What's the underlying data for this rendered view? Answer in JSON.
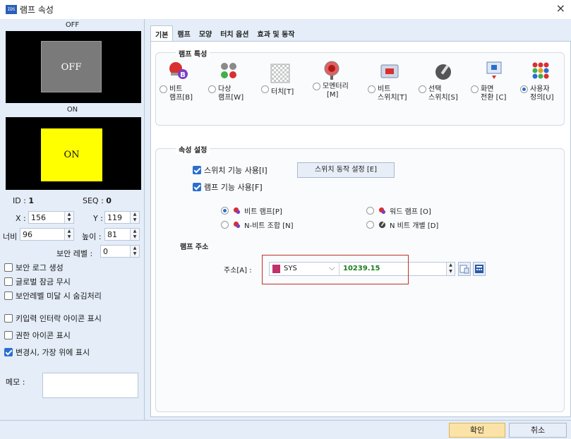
{
  "window": {
    "title": "램프 속성",
    "app_icon_text": "IDS",
    "close_glyph": "×"
  },
  "left": {
    "off_label": "OFF",
    "off_lamp_text": "OFF",
    "on_label": "ON",
    "on_lamp_text": "ON",
    "id_label": "ID :",
    "id_value": "1",
    "seq_label": "SEQ :",
    "seq_value": "0",
    "x_label": "X :",
    "x_value": "156",
    "y_label": "Y :",
    "y_value": "119",
    "width_label": "너비 :",
    "width_value": "96",
    "height_label": "높이 :",
    "height_value": "81",
    "security_label": "보안 레벨 :",
    "security_value": "0",
    "checkboxes": [
      {
        "label": "보안 로그 생성",
        "checked": false
      },
      {
        "label": "글로벌 잠금 무시",
        "checked": false
      },
      {
        "label": "보안레벨 미달 시 숨김처리",
        "checked": false
      },
      {
        "label": "키입력 인터락 아이콘 표시",
        "checked": false
      },
      {
        "label": "권한 아이콘 표시",
        "checked": false
      },
      {
        "label": "변경시, 가장 위에 표시",
        "checked": true
      }
    ],
    "memo_label": "메모 :"
  },
  "tabs": [
    "기본",
    "램프",
    "모양",
    "터치 옵션",
    "효과 및 동작"
  ],
  "lamp_types": {
    "group_title": "램프 특성",
    "items": [
      {
        "label_l1": "비트",
        "label_l2": "램프[B]",
        "selected": false
      },
      {
        "label_l1": "다상",
        "label_l2": "램프[W]",
        "selected": false
      },
      {
        "label_l1": "터치[T]",
        "label_l2": "",
        "selected": false
      },
      {
        "label_l1": "모멘터리",
        "label_l2": "[M]",
        "selected": false
      },
      {
        "label_l1": "비트",
        "label_l2": "스위치[T]",
        "selected": false
      },
      {
        "label_l1": "선택",
        "label_l2": "스위치[S]",
        "selected": false
      },
      {
        "label_l1": "화면",
        "label_l2": "전환 [C]",
        "selected": false
      },
      {
        "label_l1": "사용자",
        "label_l2": "정의[U]",
        "selected": true
      }
    ]
  },
  "attr": {
    "group_title": "속성 설정",
    "use_switch_label": "스위치 기능 사용[I]",
    "switch_setting_button": "스위치 동작 설정 [E]",
    "use_lamp_label": "램프 기능 사용[F]",
    "options": [
      {
        "label": "비트 램프[P]",
        "selected": true
      },
      {
        "label": "워드 램프 [O]",
        "selected": false
      },
      {
        "label": "N-비트 조합 [N]",
        "selected": false
      },
      {
        "label": "N 비트 개별 [D]",
        "selected": false
      }
    ],
    "lamp_address_title": "램프 주소",
    "address_label": "주소[A] :",
    "device": "SYS",
    "address_value": "10239.15"
  },
  "footer": {
    "ok": "확인",
    "cancel": "취소"
  }
}
